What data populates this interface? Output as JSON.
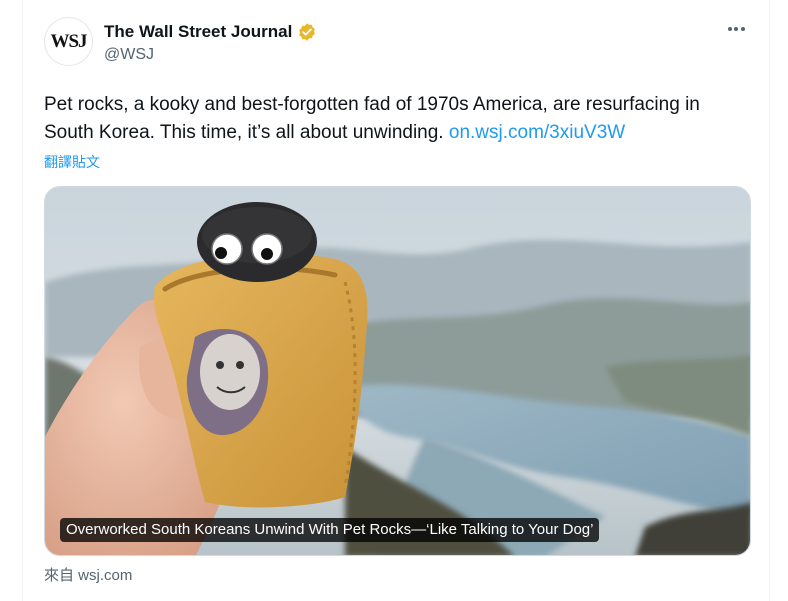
{
  "account": {
    "display_name": "The Wall Street Journal",
    "handle": "@WSJ",
    "avatar_text": "WSJ",
    "verified_badge": "gold-verified-icon"
  },
  "tweet": {
    "text": "Pet rocks, a kooky and best-forgotten fad of 1970s America, are resurfacing in South Korea. This time, it’s all about unwinding. ",
    "link_text": "on.wsj.com/3xiuV3W",
    "translate_label": "翻譯貼文"
  },
  "card": {
    "caption": "Overworked South Koreans Unwind With Pet Rocks—‘Like Talking to Your Dog’",
    "image_subject": "hand holding googly-eyed pet rock in towel sleeve over river valley"
  },
  "source": {
    "label": "來自 wsj.com"
  },
  "colors": {
    "link": "#1d9bf0",
    "secondary_text": "#536471",
    "primary_text": "#0f1419",
    "verified_gold": "#e8b828"
  }
}
